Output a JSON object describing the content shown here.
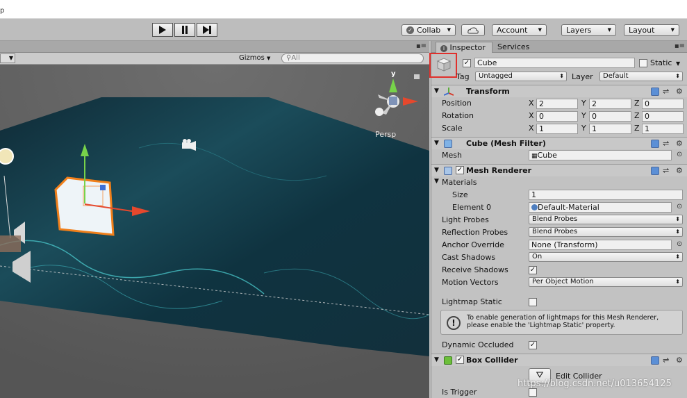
{
  "titlebar": {
    "text": "p"
  },
  "toolbar": {
    "collab": "Collab",
    "account": "Account",
    "layers": "Layers",
    "layout": "Layout",
    "play_icon": "play-icon",
    "pause_icon": "pause-icon",
    "step_icon": "step-icon"
  },
  "scene": {
    "gizmos_label": "Gizmos",
    "search_placeholder": "All",
    "gizmo_y": "y",
    "persp_label": "Persp"
  },
  "inspector": {
    "tab_inspector": "Inspector",
    "tab_services": "Services",
    "object_name": "Cube",
    "static_label": "Static",
    "tag_label": "Tag",
    "tag_value": "Untagged",
    "layer_label": "Layer",
    "layer_value": "Default",
    "transform": {
      "title": "Transform",
      "rows": [
        {
          "label": "Position",
          "x": "2",
          "y": "2",
          "z": "0"
        },
        {
          "label": "Rotation",
          "x": "0",
          "y": "0",
          "z": "0"
        },
        {
          "label": "Scale",
          "x": "1",
          "y": "1",
          "z": "1"
        }
      ],
      "x_label": "X",
      "y_label": "Y",
      "z_label": "Z"
    },
    "mesh_filter": {
      "title": "Cube (Mesh Filter)",
      "mesh_label": "Mesh",
      "mesh_value": "Cube"
    },
    "mesh_renderer": {
      "title": "Mesh Renderer",
      "materials_label": "Materials",
      "size_label": "Size",
      "size_value": "1",
      "element_label": "Element 0",
      "element_value": "Default-Material",
      "light_probes_label": "Light Probes",
      "light_probes_value": "Blend Probes",
      "reflection_probes_label": "Reflection Probes",
      "reflection_probes_value": "Blend Probes",
      "anchor_label": "Anchor Override",
      "anchor_value": "None (Transform)",
      "cast_label": "Cast Shadows",
      "cast_value": "On",
      "receive_label": "Receive Shadows",
      "motion_label": "Motion Vectors",
      "motion_value": "Per Object Motion",
      "lightmap_label": "Lightmap Static",
      "info_line1": "To enable generation of lightmaps for this Mesh Renderer,",
      "info_line2": "please enable the 'Lightmap Static' property.",
      "dynamic_label": "Dynamic Occluded"
    },
    "box_collider": {
      "title": "Box Collider",
      "edit_label": "Edit Collider",
      "trigger_label": "Is Trigger"
    }
  },
  "watermark": "https://blog.csdn.net/u013654125"
}
